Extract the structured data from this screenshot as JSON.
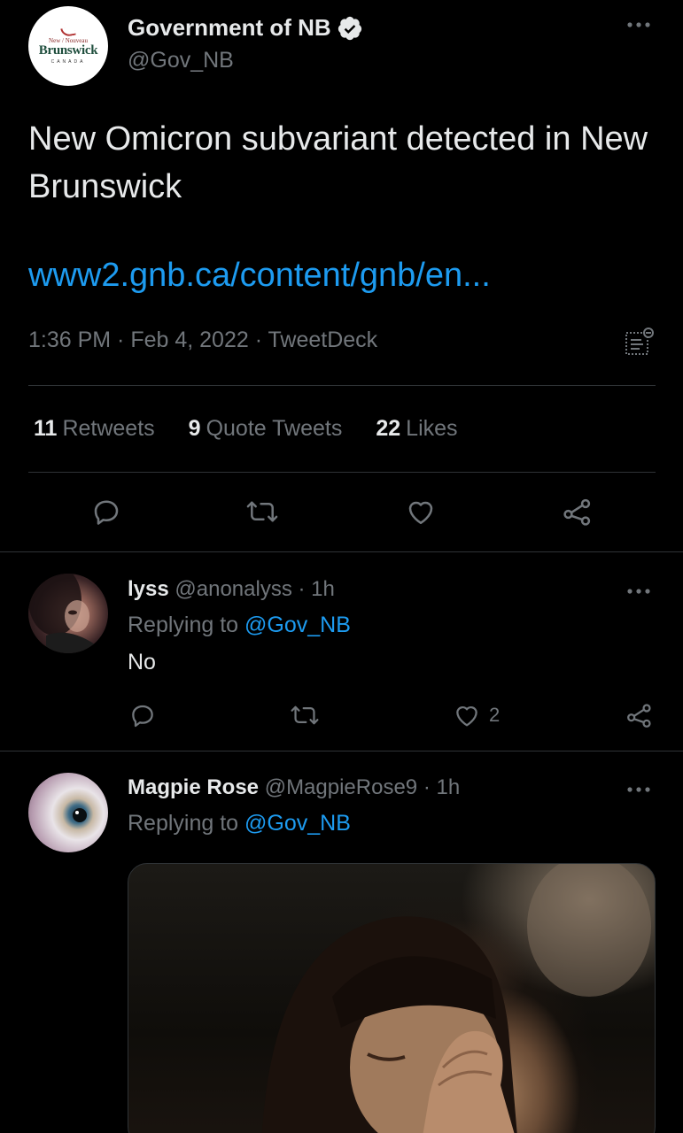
{
  "tweet": {
    "author": {
      "display_name": "Government of NB",
      "handle": "@Gov_NB",
      "logo": {
        "small_text": "New / Nouveau",
        "word": "Brunswick",
        "country": "CANADA"
      }
    },
    "text": "New Omicron subvariant detected in New Brunswick",
    "link": "www2.gnb.ca/content/gnb/en...",
    "meta": "1:36 PM · Feb 4, 2022 · TweetDeck",
    "stats": {
      "retweets_count": "11",
      "retweets_label": "Retweets",
      "quotes_count": "9",
      "quotes_label": "Quote Tweets",
      "likes_count": "22",
      "likes_label": "Likes"
    }
  },
  "replies": [
    {
      "display_name": "lyss",
      "handle_time": "@anonalyss · 1h",
      "replying_prefix": "Replying to",
      "replying_to": "@Gov_NB",
      "text": "No",
      "likes": "2"
    },
    {
      "display_name": "Magpie Rose",
      "handle_time": "@MagpieRose9 · 1h",
      "replying_prefix": "Replying to",
      "replying_to": "@Gov_NB"
    }
  ],
  "colors": {
    "accent": "#1d9bf0",
    "muted": "#71767b",
    "text": "#e7e9ea",
    "divider": "#2f3336",
    "background": "#000000"
  },
  "icons": [
    "verified-badge-icon",
    "more-icon",
    "analytics-icon",
    "reply-icon",
    "retweet-icon",
    "like-icon",
    "share-icon"
  ]
}
